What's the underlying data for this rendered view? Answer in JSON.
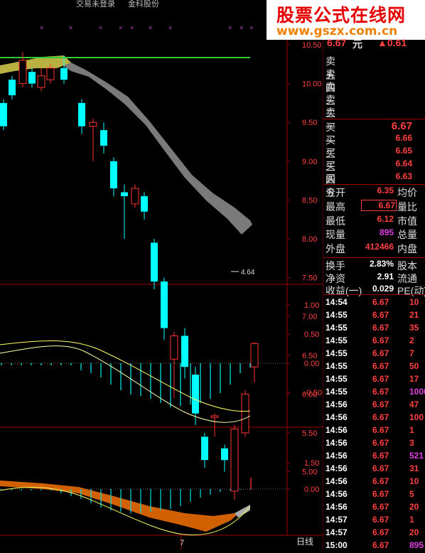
{
  "topbar": {
    "status": "交易未登录",
    "stock_name": "金科股份"
  },
  "watermark": {
    "title": "股票公式在线网",
    "url": "www.gszx.com.cn"
  },
  "price_axis": {
    "ticks": [
      "10.50",
      "10.00",
      "9.50",
      "9.00",
      "8.50",
      "8.00",
      "7.50",
      "7.00",
      "6.50",
      "6.00",
      "5.50",
      "5.00"
    ]
  },
  "low_marker": "4.64",
  "panel2_axis": {
    "ticks": [
      "1.00",
      "0.50",
      "0.00",
      "-0.50"
    ]
  },
  "panel3_axis": {
    "ticks": [
      "1.50",
      "0.00"
    ]
  },
  "bottom": {
    "x_label": "7",
    "period": "日线"
  },
  "colors": {
    "up": "#ff3232",
    "down": "#00ffff",
    "band": "#808080",
    "ma_line": "#33cc33",
    "diff_line": "#ffff66",
    "dea_line": "#ffffff",
    "orange_band": "#d06000"
  },
  "quote": {
    "header": {
      "price": "6.67",
      "unit": "元",
      "change": "▲0.61"
    },
    "asks": [
      {
        "label": "卖五",
        "price": ""
      },
      {
        "label": "卖四",
        "price": ""
      },
      {
        "label": "卖三",
        "price": ""
      },
      {
        "label": "卖二",
        "price": ""
      },
      {
        "label": "卖一",
        "price": ""
      }
    ],
    "bids": [
      {
        "label": "买一",
        "price": "6.67"
      },
      {
        "label": "买二",
        "price": "6.66"
      },
      {
        "label": "买三",
        "price": "6.65"
      },
      {
        "label": "买四",
        "price": "6.64"
      },
      {
        "label": "买五",
        "price": "6.63"
      }
    ],
    "stats": [
      {
        "label": "今开",
        "value": "6.35",
        "label2": "均价"
      },
      {
        "label": "最高",
        "value": "6.67",
        "label2": "量比"
      },
      {
        "label": "最低",
        "value": "6.12",
        "label2": "市值"
      },
      {
        "label": "现量",
        "value": "895",
        "label2": "总量"
      },
      {
        "label": "外盘",
        "value": "412466",
        "label2": "内盘"
      },
      {
        "label": "换手",
        "value": "2.83%",
        "label2": "股本"
      },
      {
        "label": "净资",
        "value": "2.91",
        "label2": "流通"
      },
      {
        "label": "收益(一)",
        "value": "0.029",
        "label2": "PE(动)"
      }
    ]
  },
  "ticks_list": [
    {
      "time": "14:54",
      "price": "6.67",
      "vol": "10"
    },
    {
      "time": "14:55",
      "price": "6.67",
      "vol": "21"
    },
    {
      "time": "14:55",
      "price": "6.67",
      "vol": "35"
    },
    {
      "time": "14:55",
      "price": "6.67",
      "vol": "2"
    },
    {
      "time": "14:55",
      "price": "6.67",
      "vol": "7"
    },
    {
      "time": "14:55",
      "price": "6.67",
      "vol": "50"
    },
    {
      "time": "14:55",
      "price": "6.67",
      "vol": "17"
    },
    {
      "time": "14:55",
      "price": "6.67",
      "vol": "1000"
    },
    {
      "time": "14:56",
      "price": "6.67",
      "vol": "47"
    },
    {
      "time": "14:56",
      "price": "6.67",
      "vol": "100"
    },
    {
      "time": "14:56",
      "price": "6.67",
      "vol": "1"
    },
    {
      "time": "14:56",
      "price": "6.67",
      "vol": "3"
    },
    {
      "time": "14:56",
      "price": "6.67",
      "vol": "521"
    },
    {
      "time": "14:56",
      "price": "6.67",
      "vol": "31"
    },
    {
      "time": "14:56",
      "price": "6.67",
      "vol": "10"
    },
    {
      "time": "14:56",
      "price": "6.67",
      "vol": "5"
    },
    {
      "time": "14:56",
      "price": "6.67",
      "vol": "20"
    },
    {
      "time": "14:57",
      "price": "6.67",
      "vol": "1"
    },
    {
      "time": "14:57",
      "price": "6.67",
      "vol": "20"
    },
    {
      "time": "15:00",
      "price": "6.67",
      "vol": "895"
    }
  ],
  "tick_vol_colors": [
    "#ff4040",
    "#ff4040",
    "#ff4040",
    "#ff4040",
    "#ff4040",
    "#ff4040",
    "#ff4040",
    "#e040e0",
    "#ff4040",
    "#ff4040",
    "#ff4040",
    "#ff4040",
    "#e040e0",
    "#ff4040",
    "#ff4040",
    "#ff4040",
    "#ff4040",
    "#ff4040",
    "#ff4040",
    "#e040e0"
  ]
}
